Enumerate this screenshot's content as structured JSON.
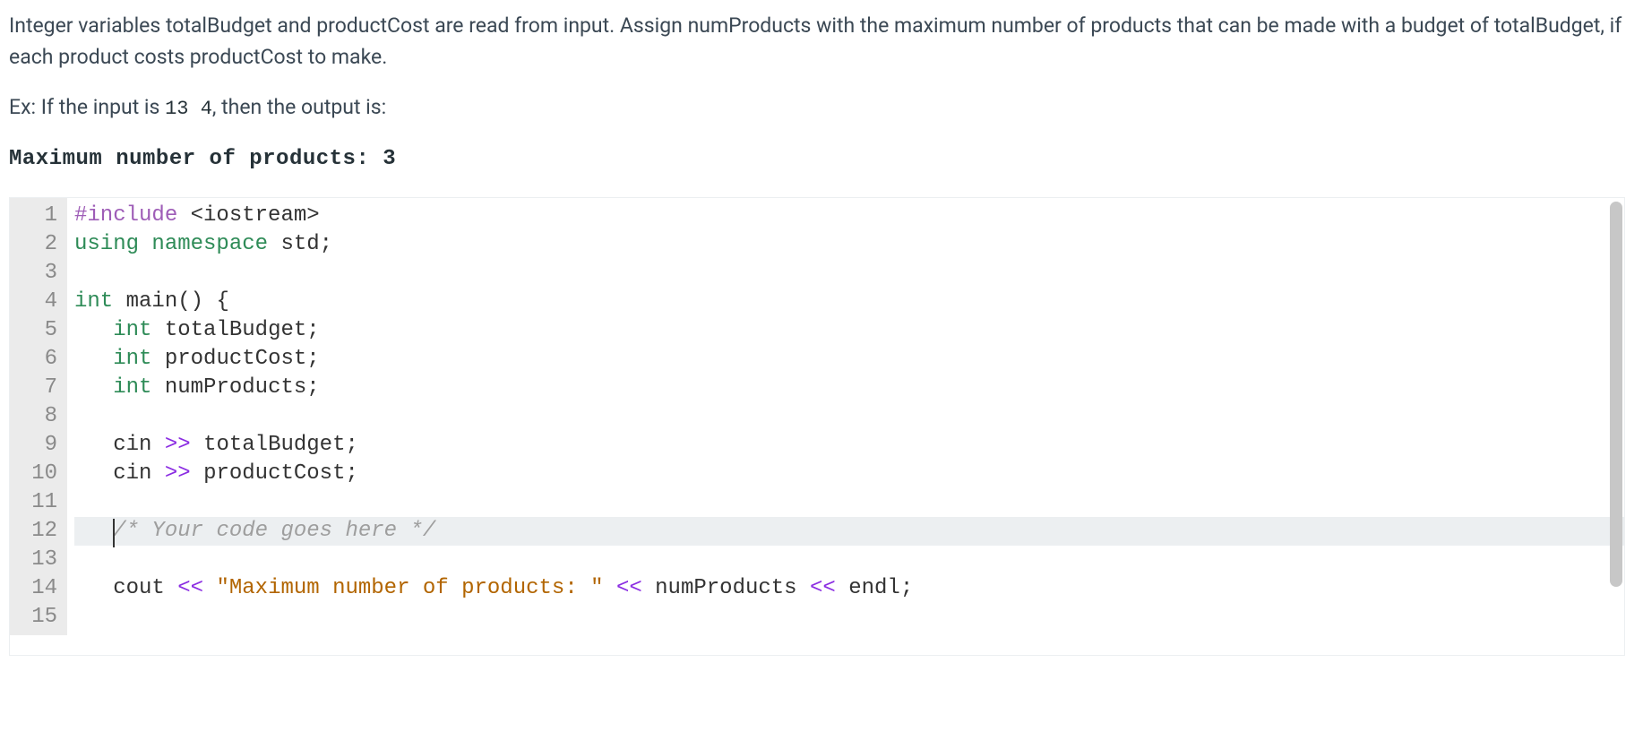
{
  "description": {
    "paragraph1": "Integer variables totalBudget and productCost are read from input. Assign numProducts with the maximum number of products that can be made with a budget of totalBudget, if each product costs productCost to make.",
    "example_prefix": "Ex: If the input is ",
    "example_input": "13  4",
    "example_suffix": ", then the output is:",
    "output_line": "Maximum number of products: 3"
  },
  "editor": {
    "active_line": 12,
    "lines": [
      {
        "n": 1,
        "tokens": [
          {
            "cls": "tok-preproc",
            "t": "#include"
          },
          {
            "cls": "tok-header",
            "t": " <iostream>"
          }
        ]
      },
      {
        "n": 2,
        "tokens": [
          {
            "cls": "tok-keyword",
            "t": "using"
          },
          {
            "cls": "",
            "t": " "
          },
          {
            "cls": "tok-ns-key",
            "t": "namespace"
          },
          {
            "cls": "",
            "t": " "
          },
          {
            "cls": "tok-ident",
            "t": "std"
          },
          {
            "cls": "tok-punct",
            "t": ";"
          }
        ]
      },
      {
        "n": 3,
        "tokens": []
      },
      {
        "n": 4,
        "tokens": [
          {
            "cls": "tok-type",
            "t": "int"
          },
          {
            "cls": "",
            "t": " "
          },
          {
            "cls": "tok-ident",
            "t": "main"
          },
          {
            "cls": "tok-punct",
            "t": "()"
          },
          {
            "cls": "",
            "t": " "
          },
          {
            "cls": "tok-punct",
            "t": "{"
          }
        ]
      },
      {
        "n": 5,
        "tokens": [
          {
            "cls": "",
            "t": "   "
          },
          {
            "cls": "tok-type",
            "t": "int"
          },
          {
            "cls": "",
            "t": " "
          },
          {
            "cls": "tok-ident",
            "t": "totalBudget"
          },
          {
            "cls": "tok-punct",
            "t": ";"
          }
        ]
      },
      {
        "n": 6,
        "tokens": [
          {
            "cls": "",
            "t": "   "
          },
          {
            "cls": "tok-type",
            "t": "int"
          },
          {
            "cls": "",
            "t": " "
          },
          {
            "cls": "tok-ident",
            "t": "productCost"
          },
          {
            "cls": "tok-punct",
            "t": ";"
          }
        ]
      },
      {
        "n": 7,
        "tokens": [
          {
            "cls": "",
            "t": "   "
          },
          {
            "cls": "tok-type",
            "t": "int"
          },
          {
            "cls": "",
            "t": " "
          },
          {
            "cls": "tok-ident",
            "t": "numProducts"
          },
          {
            "cls": "tok-punct",
            "t": ";"
          }
        ]
      },
      {
        "n": 8,
        "tokens": []
      },
      {
        "n": 9,
        "tokens": [
          {
            "cls": "",
            "t": "   "
          },
          {
            "cls": "tok-ident",
            "t": "cin"
          },
          {
            "cls": "",
            "t": " "
          },
          {
            "cls": "tok-op",
            "t": ">>"
          },
          {
            "cls": "",
            "t": " "
          },
          {
            "cls": "tok-ident",
            "t": "totalBudget"
          },
          {
            "cls": "tok-punct",
            "t": ";"
          }
        ]
      },
      {
        "n": 10,
        "tokens": [
          {
            "cls": "",
            "t": "   "
          },
          {
            "cls": "tok-ident",
            "t": "cin"
          },
          {
            "cls": "",
            "t": " "
          },
          {
            "cls": "tok-op",
            "t": ">>"
          },
          {
            "cls": "",
            "t": " "
          },
          {
            "cls": "tok-ident",
            "t": "productCost"
          },
          {
            "cls": "tok-punct",
            "t": ";"
          }
        ]
      },
      {
        "n": 11,
        "tokens": []
      },
      {
        "n": 12,
        "cursor": true,
        "tokens": [
          {
            "cls": "",
            "t": "   "
          },
          {
            "cls": "tok-comment",
            "t": "/* Your code goes here */"
          }
        ]
      },
      {
        "n": 13,
        "tokens": []
      },
      {
        "n": 14,
        "tokens": [
          {
            "cls": "",
            "t": "   "
          },
          {
            "cls": "tok-ident",
            "t": "cout"
          },
          {
            "cls": "",
            "t": " "
          },
          {
            "cls": "tok-op",
            "t": "<<"
          },
          {
            "cls": "",
            "t": " "
          },
          {
            "cls": "tok-string",
            "t": "\"Maximum number of products: \""
          },
          {
            "cls": "",
            "t": " "
          },
          {
            "cls": "tok-op",
            "t": "<<"
          },
          {
            "cls": "",
            "t": " "
          },
          {
            "cls": "tok-ident",
            "t": "numProducts"
          },
          {
            "cls": "",
            "t": " "
          },
          {
            "cls": "tok-op",
            "t": "<<"
          },
          {
            "cls": "",
            "t": " "
          },
          {
            "cls": "tok-ident",
            "t": "endl"
          },
          {
            "cls": "tok-punct",
            "t": ";"
          }
        ]
      },
      {
        "n": 15,
        "tokens": []
      }
    ]
  }
}
